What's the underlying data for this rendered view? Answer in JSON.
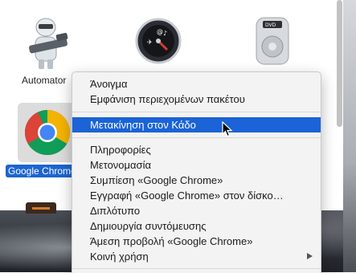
{
  "apps": [
    {
      "name": "automator",
      "label": "Automator"
    },
    {
      "name": "dashboard",
      "label": ""
    },
    {
      "name": "dvd-player",
      "label": ""
    }
  ],
  "selected_item": {
    "label": "Google Chrome"
  },
  "context_menu": {
    "items": [
      {
        "id": "open",
        "label": "Άνοιγμα"
      },
      {
        "id": "show-package-contents",
        "label": "Εμφάνιση περιεχομένων πακέτου"
      },
      {
        "id": "move-to-trash",
        "label": "Μετακίνηση στον Κάδο",
        "highlighted": true
      },
      {
        "id": "get-info",
        "label": "Πληροφορίες"
      },
      {
        "id": "rename",
        "label": "Μετονομασία"
      },
      {
        "id": "compress",
        "label": "Συμπίεση «Google Chrome»"
      },
      {
        "id": "burn-to-disc",
        "label": "Εγγραφή «Google Chrome» στον δίσκο…"
      },
      {
        "id": "duplicate",
        "label": "Διπλότυπο"
      },
      {
        "id": "make-alias",
        "label": "Δημιουργία συντόμευσης"
      },
      {
        "id": "quick-look",
        "label": "Άμεση προβολή «Google Chrome»"
      },
      {
        "id": "share",
        "label": "Κοινή χρήση",
        "submenu": true
      }
    ]
  },
  "colors": {
    "highlight": "#1b63d6",
    "selection_label": "#1c65d0"
  },
  "icons": [
    "automator-icon",
    "dashboard-icon",
    "dvd-player-icon",
    "chrome-icon",
    "submenu-arrow-icon",
    "pointer-cursor-icon"
  ]
}
